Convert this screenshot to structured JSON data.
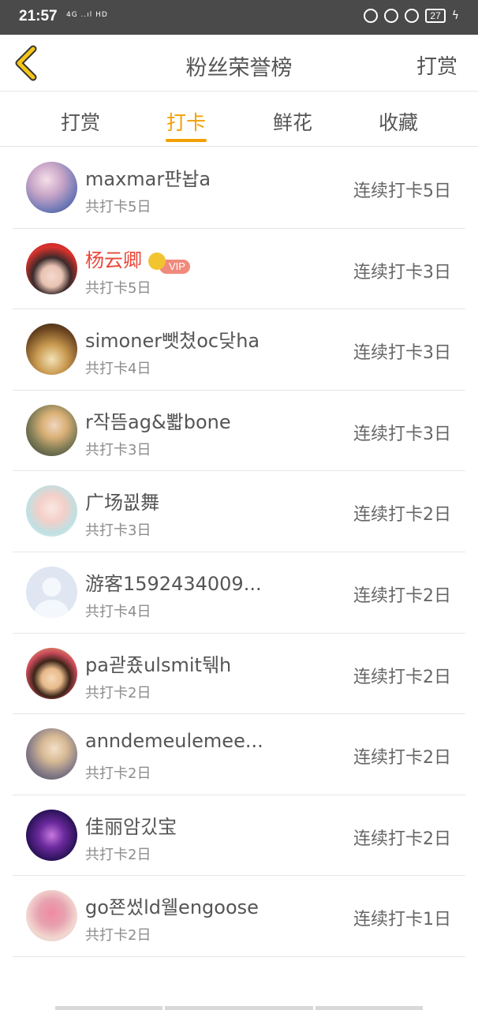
{
  "status_bar": {
    "time": "21:57",
    "signal": "4G ..ıl HD",
    "battery": "27"
  },
  "header": {
    "title": "粉丝荣誉榜",
    "right_action": "打赏"
  },
  "tabs": [
    {
      "label": "打赏",
      "active": false
    },
    {
      "label": "打卡",
      "active": true
    },
    {
      "label": "鲜花",
      "active": false
    },
    {
      "label": "收藏",
      "active": false
    }
  ],
  "accent_color": "#f2a000",
  "vip_label": "VIP",
  "rows": [
    {
      "name": "maxmar퍈놥a",
      "total": "共打卡5日",
      "streak": "连续打卡5日",
      "vip": false
    },
    {
      "name": "杨云卿",
      "total": "共打卡5日",
      "streak": "连续打卡3日",
      "vip": true
    },
    {
      "name": "simoner뺏쳤oc닺ha",
      "total": "共打卡4日",
      "streak": "连续打卡3日",
      "vip": false
    },
    {
      "name": "r작뜸ag&뽧bone",
      "total": "共打卡3日",
      "streak": "连续打卡3日",
      "vip": false
    },
    {
      "name": "广场꾒舞",
      "total": "共打卡3日",
      "streak": "连续打卡2日",
      "vip": false
    },
    {
      "name": "游客1592434009...",
      "total": "共打卡4日",
      "streak": "连续打卡2日",
      "vip": false
    },
    {
      "name": "pa괃죴ulsmit뒊h",
      "total": "共打卡2日",
      "streak": "连续打卡2日",
      "vip": false
    },
    {
      "name": "anndemeulemee...",
      "total": "共打卡2日",
      "streak": "连续打卡2日",
      "vip": false
    },
    {
      "name": "佳丽암깄宝",
      "total": "共打卡2日",
      "streak": "连续打卡2日",
      "vip": false
    },
    {
      "name": "go쬰썼ld웰engoose",
      "total": "共打卡2日",
      "streak": "连续打卡1日",
      "vip": false
    }
  ]
}
